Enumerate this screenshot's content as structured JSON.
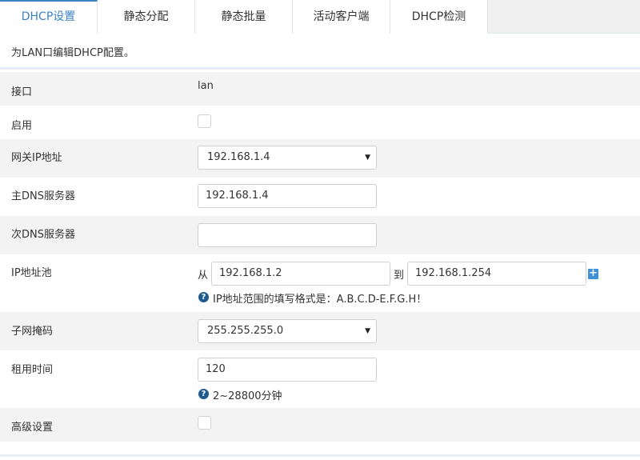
{
  "tabs": [
    {
      "label": "DHCP设置",
      "active": true
    },
    {
      "label": "静态分配",
      "active": false
    },
    {
      "label": "静态批量",
      "active": false
    },
    {
      "label": "活动客户端",
      "active": false
    },
    {
      "label": "DHCP检测",
      "active": false
    }
  ],
  "description": "为LAN口编辑DHCP配置。",
  "form": {
    "interface": {
      "label": "接口",
      "value": "lan"
    },
    "enable": {
      "label": "启用",
      "checked": false
    },
    "gateway": {
      "label": "网关IP地址",
      "selected": "192.168.1.4"
    },
    "primary_dns": {
      "label": "主DNS服务器",
      "value": "192.168.1.4"
    },
    "secondary_dns": {
      "label": "次DNS服务器",
      "value": ""
    },
    "ip_pool": {
      "label": "IP地址池",
      "from_word": "从",
      "to_word": "到",
      "start": "192.168.1.2",
      "end": "192.168.1.254",
      "help": "IP地址范围的填写格式是：A.B.C.D-E.F.G.H！"
    },
    "subnet_mask": {
      "label": "子网掩码",
      "selected": "255.255.255.0"
    },
    "lease_time": {
      "label": "租用时间",
      "value": "120",
      "help": "2~28800分钟"
    },
    "advanced": {
      "label": "高级设置",
      "checked": false
    }
  },
  "icons": {
    "help": "question-circle-icon",
    "add": "plus-square-icon",
    "dropdown": "caret-down-icon"
  },
  "colors": {
    "accent": "#3b82c4",
    "row_alt": "#f3f3f3",
    "help_icon": "#1f5a8e",
    "plus": "#3d8fd8"
  }
}
